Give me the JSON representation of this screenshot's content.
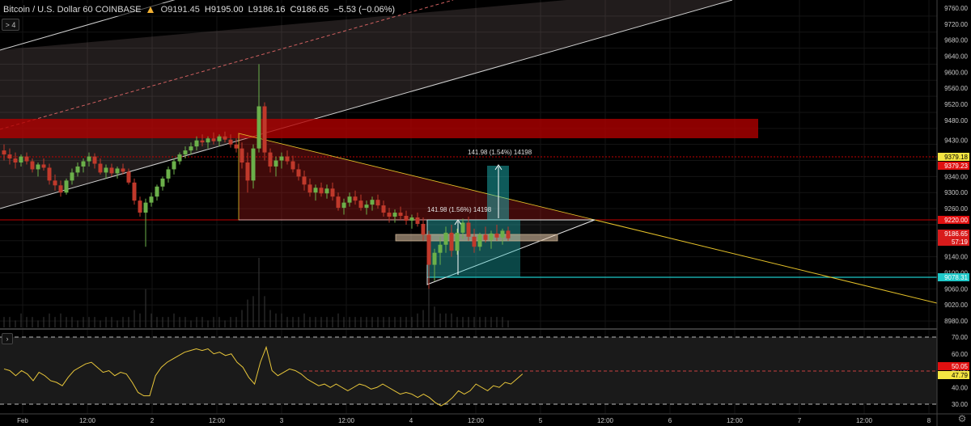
{
  "header": {
    "symbol": "Bitcoin / U.S. Dollar  60  COINBASE",
    "open": "O9191.45",
    "high": "H9195.00",
    "low": "L9186.16",
    "close": "C9186.65",
    "change": "−5.53 (−0.06%)",
    "collapse_label": "> 4",
    "logo_icon": "coinbase-logo-icon"
  },
  "price_axis": {
    "ticks": [
      "9760.00",
      "9720.00",
      "9680.00",
      "9640.00",
      "9600.00",
      "9560.00",
      "9520.00",
      "9480.00",
      "9430.00",
      "9379.18",
      "9379.23",
      "9340.00",
      "9300.00",
      "9260.00",
      "9220.00",
      "9186.65",
      "57:19",
      "9140.00",
      "9100.00",
      "9078.31",
      "9060.00",
      "9020.00",
      "8980.00"
    ]
  },
  "price_levels": {
    "label_a": "9379.18",
    "label_b": "9379.23",
    "label_c": "9220.00",
    "label_d": "9186.65",
    "label_e": "57:19",
    "label_f": "9078.31"
  },
  "annotations": {
    "measure_top": "141.98 (1.54%) 14198",
    "measure_mid": "141.98 (1.56%) 14198"
  },
  "rsi_axis": {
    "ticks": [
      "70.00",
      "60.00",
      "50.00",
      "40.00",
      "30.00"
    ],
    "label_a": "50.05",
    "label_b": "47.79"
  },
  "time_axis": {
    "labels": [
      "Feb",
      "12:00",
      "2",
      "12:00",
      "3",
      "12:00",
      "4",
      "12:00",
      "5",
      "12:00",
      "6",
      "12:00",
      "7",
      "12:00",
      "8"
    ]
  },
  "colors": {
    "background": "#000000",
    "up_candle": "#6bb04a",
    "down_candle": "#c0392b",
    "resistance_zone": "#c40000",
    "rsi_line": "#e8c63a",
    "trendline": "#e6c229",
    "teal": "#1ec8c8"
  },
  "chart_data": {
    "type": "candlestick",
    "symbol": "Bitcoin / U.S. Dollar",
    "interval": "60",
    "exchange": "COINBASE",
    "y_range": [
      8960,
      9780
    ],
    "x_labels": [
      "Feb",
      "12:00",
      "2",
      "12:00",
      "3",
      "12:00",
      "4",
      "12:00",
      "5",
      "12:00",
      "6",
      "12:00",
      "7",
      "12:00",
      "8"
    ],
    "candles": [
      [
        9405,
        9420,
        9380,
        9395
      ],
      [
        9395,
        9410,
        9370,
        9385
      ],
      [
        9385,
        9400,
        9360,
        9375
      ],
      [
        9375,
        9395,
        9365,
        9390
      ],
      [
        9390,
        9400,
        9370,
        9378
      ],
      [
        9378,
        9385,
        9350,
        9358
      ],
      [
        9358,
        9375,
        9340,
        9370
      ],
      [
        9370,
        9385,
        9355,
        9362
      ],
      [
        9362,
        9372,
        9320,
        9330
      ],
      [
        9330,
        9345,
        9305,
        9318
      ],
      [
        9318,
        9330,
        9290,
        9300
      ],
      [
        9300,
        9335,
        9295,
        9330
      ],
      [
        9330,
        9360,
        9320,
        9350
      ],
      [
        9350,
        9375,
        9340,
        9365
      ],
      [
        9365,
        9385,
        9350,
        9378
      ],
      [
        9378,
        9400,
        9365,
        9390
      ],
      [
        9390,
        9398,
        9360,
        9372
      ],
      [
        9372,
        9385,
        9345,
        9350
      ],
      [
        9350,
        9370,
        9335,
        9362
      ],
      [
        9362,
        9372,
        9340,
        9348
      ],
      [
        9348,
        9365,
        9335,
        9360
      ],
      [
        9360,
        9372,
        9345,
        9352
      ],
      [
        9352,
        9360,
        9320,
        9325
      ],
      [
        9325,
        9335,
        9270,
        9280
      ],
      [
        9280,
        9290,
        9240,
        9250
      ],
      [
        9250,
        9285,
        9165,
        9275
      ],
      [
        9275,
        9300,
        9265,
        9290
      ],
      [
        9290,
        9320,
        9280,
        9315
      ],
      [
        9315,
        9340,
        9305,
        9335
      ],
      [
        9335,
        9365,
        9325,
        9358
      ],
      [
        9358,
        9385,
        9345,
        9378
      ],
      [
        9378,
        9400,
        9370,
        9395
      ],
      [
        9395,
        9415,
        9385,
        9405
      ],
      [
        9405,
        9425,
        9395,
        9415
      ],
      [
        9415,
        9440,
        9405,
        9430
      ],
      [
        9430,
        9445,
        9415,
        9425
      ],
      [
        9425,
        9440,
        9410,
        9435
      ],
      [
        9435,
        9450,
        9420,
        9428
      ],
      [
        9428,
        9445,
        9415,
        9440
      ],
      [
        9440,
        9452,
        9425,
        9432
      ],
      [
        9432,
        9445,
        9412,
        9420
      ],
      [
        9420,
        9435,
        9400,
        9410
      ],
      [
        9410,
        9425,
        9360,
        9375
      ],
      [
        9375,
        9400,
        9300,
        9330
      ],
      [
        9330,
        9420,
        9310,
        9410
      ],
      [
        9410,
        9620,
        9400,
        9515
      ],
      [
        9515,
        9525,
        9380,
        9400
      ],
      [
        9400,
        9410,
        9350,
        9365
      ],
      [
        9365,
        9390,
        9340,
        9380
      ],
      [
        9380,
        9400,
        9360,
        9390
      ],
      [
        9390,
        9405,
        9370,
        9378
      ],
      [
        9378,
        9392,
        9350,
        9358
      ],
      [
        9358,
        9372,
        9330,
        9340
      ],
      [
        9340,
        9355,
        9305,
        9320
      ],
      [
        9320,
        9335,
        9290,
        9300
      ],
      [
        9300,
        9320,
        9280,
        9312
      ],
      [
        9312,
        9325,
        9290,
        9298
      ],
      [
        9298,
        9320,
        9285,
        9310
      ],
      [
        9310,
        9325,
        9280,
        9290
      ],
      [
        9290,
        9300,
        9255,
        9262
      ],
      [
        9262,
        9285,
        9245,
        9275
      ],
      [
        9275,
        9300,
        9265,
        9290
      ],
      [
        9290,
        9305,
        9270,
        9280
      ],
      [
        9280,
        9295,
        9255,
        9262
      ],
      [
        9262,
        9280,
        9245,
        9270
      ],
      [
        9270,
        9290,
        9255,
        9282
      ],
      [
        9282,
        9295,
        9260,
        9268
      ],
      [
        9268,
        9280,
        9240,
        9250
      ],
      [
        9250,
        9262,
        9225,
        9240
      ],
      [
        9240,
        9258,
        9225,
        9250
      ],
      [
        9250,
        9265,
        9232,
        9242
      ],
      [
        9242,
        9255,
        9220,
        9230
      ],
      [
        9230,
        9245,
        9210,
        9238
      ],
      [
        9238,
        9250,
        9215,
        9222
      ],
      [
        9222,
        9238,
        9180,
        9195
      ],
      [
        9195,
        9205,
        9060,
        9120
      ],
      [
        9120,
        9160,
        9080,
        9150
      ],
      [
        9150,
        9190,
        9120,
        9170
      ],
      [
        9170,
        9215,
        9150,
        9200
      ],
      [
        9200,
        9220,
        9140,
        9155
      ],
      [
        9155,
        9210,
        9145,
        9200
      ],
      [
        9200,
        9235,
        9185,
        9225
      ],
      [
        9225,
        9240,
        9180,
        9190
      ],
      [
        9190,
        9210,
        9150,
        9165
      ],
      [
        9165,
        9200,
        9155,
        9195
      ],
      [
        9195,
        9215,
        9175,
        9182
      ],
      [
        9182,
        9205,
        9160,
        9198
      ],
      [
        9198,
        9220,
        9180,
        9188
      ],
      [
        9188,
        9210,
        9170,
        9205
      ],
      [
        9205,
        9215,
        9180,
        9186
      ]
    ],
    "rsi": {
      "name": "RSI",
      "ylim": [
        25,
        75
      ],
      "levels": [
        70,
        50.05,
        30
      ],
      "last": 47.79,
      "values": [
        51,
        50,
        47,
        50,
        48,
        44,
        49,
        47,
        44,
        43,
        41,
        46,
        50,
        52,
        54,
        55,
        52,
        49,
        50,
        47,
        49,
        48,
        43,
        37,
        35,
        35,
        47,
        52,
        55,
        57,
        59,
        61,
        62,
        63,
        62,
        63,
        60,
        61,
        59,
        60,
        55,
        52,
        46,
        42,
        55,
        64,
        50,
        47,
        49,
        51,
        50,
        48,
        45,
        43,
        41,
        42,
        40,
        42,
        40,
        38,
        40,
        42,
        41,
        39,
        40,
        42,
        40,
        38,
        36,
        37,
        36,
        34,
        36,
        34,
        31,
        29,
        31,
        34,
        38,
        36,
        38,
        42,
        40,
        38,
        41,
        40,
        43,
        42,
        45,
        48
      ]
    },
    "volume": [
      3,
      3,
      2,
      4,
      3,
      3,
      2,
      3,
      4,
      3,
      4,
      3,
      3,
      2,
      3,
      3,
      3,
      2,
      3,
      3,
      2,
      3,
      3,
      5,
      4,
      11,
      4,
      3,
      3,
      3,
      4,
      3,
      3,
      2,
      3,
      3,
      2,
      3,
      3,
      2,
      3,
      3,
      5,
      8,
      9,
      20,
      9,
      5,
      4,
      4,
      3,
      3,
      3,
      4,
      3,
      3,
      3,
      3,
      3,
      4,
      3,
      3,
      3,
      3,
      3,
      3,
      3,
      3,
      3,
      3,
      3,
      3,
      3,
      4,
      5,
      13,
      6,
      4,
      4,
      4,
      3,
      3,
      3,
      3,
      3,
      3,
      3,
      3,
      3,
      2
    ]
  }
}
